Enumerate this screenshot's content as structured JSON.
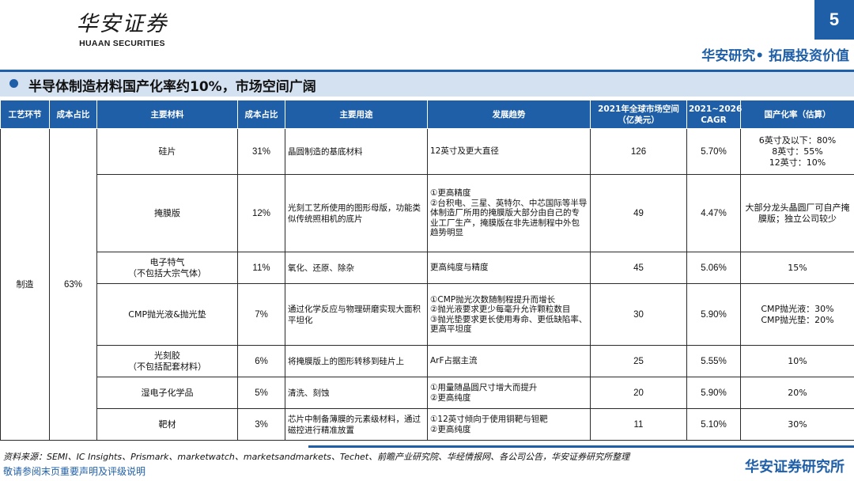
{
  "header": {
    "logo_cn": "华安证券",
    "logo_en": "HUAAN SECURITIES",
    "page_number": "5",
    "slogan": "华安研究• 拓展投资价值"
  },
  "title": "半导体制造材料国产化率约10%，市场空间广阔",
  "table": {
    "headers": [
      "工艺环节",
      "成本占比",
      "主要材料",
      "成本占比",
      "主要用途",
      "发展趋势",
      "2021年全球市场空间（亿美元）",
      "2021~2026 CAGR",
      "国产化率（估算）"
    ],
    "stage": "制造",
    "stage_share": "63%",
    "rows": [
      {
        "material": "硅片",
        "share": "31%",
        "use": "晶圆制造的基底材料",
        "trend": "12英寸及更大直径",
        "market": "126",
        "cagr": "5.70%",
        "localization": "6英寸及以下：80%\n8英寸：55%\n12英寸：10%"
      },
      {
        "material": "掩膜版",
        "share": "12%",
        "use": "光刻工艺所使用的图形母版，功能类似传统照相机的底片",
        "trend": "①更高精度\n②台积电、三星、英特尔、中芯国际等半导体制造厂所用的掩膜版大部分由自己的专业工厂生产，掩膜版在非先进制程中外包趋势明显",
        "market": "49",
        "cagr": "4.47%",
        "localization": "大部分龙头晶圆厂可自产掩膜版；独立公司较少"
      },
      {
        "material": "电子特气\n（不包括大宗气体）",
        "share": "11%",
        "use": "氧化、还原、除杂",
        "trend": "更高纯度与精度",
        "market": "45",
        "cagr": "5.06%",
        "localization": "15%"
      },
      {
        "material": "CMP抛光液&抛光垫",
        "share": "7%",
        "use": "通过化学反应与物理研磨实现大面积平坦化",
        "trend": "①CMP抛光次数随制程提升而增长\n②抛光液要求更少每毫升允许颗粒数目\n③抛光垫要求更长使用寿命、更低缺陷率、更高平坦度",
        "market": "30",
        "cagr": "5.90%",
        "localization": "CMP抛光液：30%\nCMP抛光垫：20%"
      },
      {
        "material": "光刻胶\n（不包括配套材料）",
        "share": "6%",
        "use": "将掩膜版上的图形转移到硅片上",
        "trend": "ArF占据主流",
        "market": "25",
        "cagr": "5.55%",
        "localization": "10%"
      },
      {
        "material": "湿电子化学品",
        "share": "5%",
        "use": "清洗、刻蚀",
        "trend": "①用量随晶圆尺寸增大而提升\n②更高纯度",
        "market": "20",
        "cagr": "5.90%",
        "localization": "20%"
      },
      {
        "material": "靶材",
        "share": "3%",
        "use": "芯片中制备薄膜的元素级材料，通过磁控进行精准放置",
        "trend": "①12英寸倾向于使用铜靶与钽靶\n②更高纯度",
        "market": "11",
        "cagr": "5.10%",
        "localization": "30%"
      }
    ]
  },
  "footer": {
    "source": "资料来源：SEMI、IC Insights、Prismark、marketwatch、marketsandmarkets、Techet、前瞻产业研究院、华经情报网、各公司公告，华安证券研究所整理",
    "disclaimer": "敬请参阅末页重要声明及评级说明",
    "brand": "华安证券研究所"
  }
}
